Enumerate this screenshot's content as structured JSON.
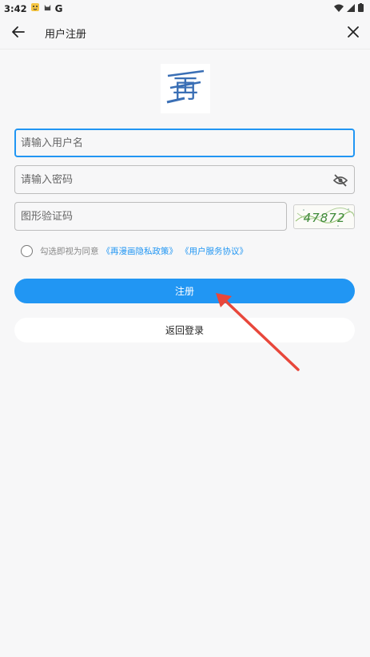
{
  "status_bar": {
    "time": "3:42",
    "icons": [
      "notification-face-icon",
      "cat-icon",
      "google-icon",
      "wifi-icon",
      "signal-icon",
      "battery-icon"
    ],
    "google_glyph": "G"
  },
  "app_bar": {
    "title": "用户注册"
  },
  "logo": {
    "character": "再"
  },
  "form": {
    "username_placeholder": "请输入用户名",
    "password_placeholder": "请输入密码",
    "captcha_placeholder": "图形验证码",
    "captcha_text": "47872"
  },
  "agreement": {
    "prefix": "勾选即视为同意",
    "privacy_link": "《再漫画隐私政策》",
    "service_link": "《用户服务协议》"
  },
  "buttons": {
    "register": "注册",
    "back_to_login": "返回登录"
  },
  "colors": {
    "accent": "#2196f3",
    "annotation_arrow": "#e8473b"
  }
}
